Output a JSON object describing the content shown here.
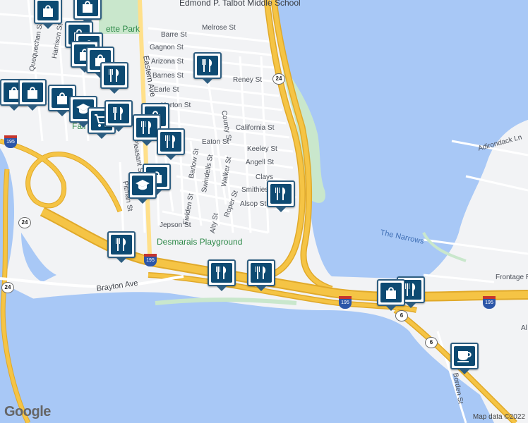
{
  "map": {
    "place_labels": {
      "school": "Edmond P. Talbot Middle School",
      "park_top": "ette Park",
      "playground": "Desmarais Playground",
      "narrows": "The Narrows",
      "fall_river": "Fall River"
    },
    "streets": {
      "melrose": "Melrose St",
      "barre": "Barre St",
      "gagnon": "Gagnon St",
      "arizona": "Arizona St",
      "barnes": "Barnes St",
      "reney": "Reney St",
      "earle": "Earle St",
      "horton": "Horton St",
      "california": "California St",
      "eaton": "Eaton St",
      "keeley": "Keeley St",
      "angell": "Angell St",
      "clays": "Clays",
      "smithies": "Smithies",
      "alsop": "Alsop St",
      "jepson": "Jepson St",
      "county": "County St",
      "walker": "Walker St",
      "swindells": "Swindells St",
      "barlow": "Barlow St",
      "fielden": "Fielden St",
      "alty": "Alty St",
      "roper": "Roper St",
      "pleasant": "Pleasant St",
      "pitman": "Pitman St",
      "eastern_ave": "Eastern Ave",
      "brayton_ave": "Brayton Ave",
      "quequechan": "Quequechan St",
      "harrison": "Harrison St",
      "adirondack": "Adirondack Ln",
      "frontage": "Frontage R",
      "borden": "Borden St",
      "al": "Al"
    },
    "route_shields": {
      "r24_top": "24",
      "r24_left": "24",
      "r24_bottom": "24",
      "i195_a": "195",
      "i195_b": "195",
      "i195_c": "195",
      "i195_d": "195",
      "r6_a": "6",
      "r6_b": "6"
    },
    "colors": {
      "water": "#a8c8f6",
      "land": "#f2f3f5",
      "highway": "#f5c445",
      "highway_edge": "#e0a92a",
      "park": "#c9e7cc",
      "pin_border": "#2d5d80",
      "pin_fill": "#0d4a72"
    },
    "pins": [
      {
        "type": "shopping",
        "icon": "shopping-bag-icon"
      },
      {
        "type": "shopping",
        "icon": "shopping-bag-icon"
      },
      {
        "type": "shopping",
        "icon": "shopping-bag-icon"
      },
      {
        "type": "shopping",
        "icon": "shopping-bag-icon"
      },
      {
        "type": "shopping",
        "icon": "shopping-bag-icon"
      },
      {
        "type": "restaurant",
        "icon": "fork-knife-icon"
      },
      {
        "type": "restaurant",
        "icon": "fork-knife-icon"
      },
      {
        "type": "restaurant",
        "icon": "fork-knife-icon"
      },
      {
        "type": "grocery",
        "icon": "shopping-cart-icon"
      },
      {
        "type": "school",
        "icon": "graduation-cap-icon"
      },
      {
        "type": "cafe",
        "icon": "coffee-cup-icon"
      }
    ]
  },
  "attribution": "Map data ©2022",
  "logo": "Google"
}
